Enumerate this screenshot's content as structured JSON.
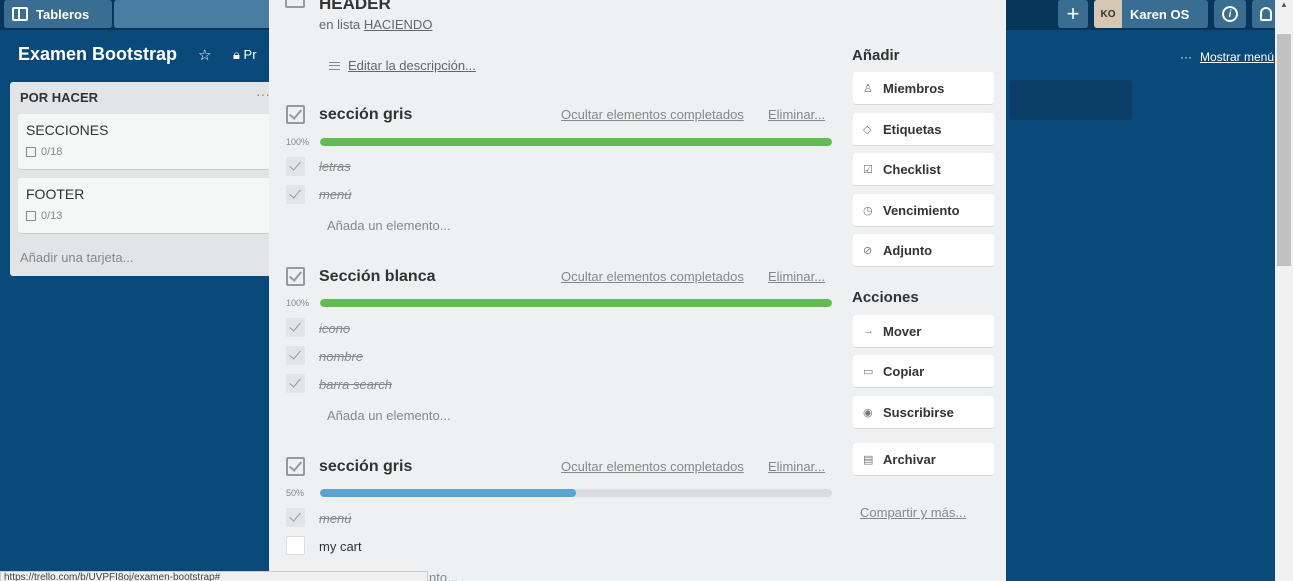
{
  "topbar": {
    "boards_label": "Tableros",
    "user_initials": "KO",
    "user_name": "Karen OS",
    "plus_glyph": "+",
    "info_glyph": "i"
  },
  "board": {
    "title": "Examen Bootstrap",
    "visibility_partial": "Pr",
    "show_menu": "Mostrar menú",
    "show_menu_dots": "···"
  },
  "list": {
    "title": "POR HACER",
    "menu_glyph": "···",
    "cards": [
      {
        "title": "SECCIONES",
        "badge": "0/18"
      },
      {
        "title": "FOOTER",
        "badge": "0/13"
      }
    ],
    "add_card": "Añadir una tarjeta..."
  },
  "card_detail": {
    "title": "HEADER",
    "in_list_prefix": "en lista ",
    "in_list_name": "HACIENDO",
    "edit_description": "Editar la descripción...",
    "checklists": [
      {
        "title": "sección gris",
        "hide_completed": "Ocultar elementos completados",
        "delete": "Eliminar...",
        "progress_label": "100%",
        "progress": 1.0,
        "bar_color": "#61bd4f",
        "items": [
          {
            "text": "letras",
            "checked": true
          },
          {
            "text": "menú",
            "checked": true
          }
        ],
        "add_item": "Añada un elemento..."
      },
      {
        "title": "Sección blanca",
        "hide_completed": "Ocultar elementos completados",
        "delete": "Eliminar...",
        "progress_label": "100%",
        "progress": 1.0,
        "bar_color": "#61bd4f",
        "items": [
          {
            "text": "icono",
            "checked": true
          },
          {
            "text": "nombre",
            "checked": true
          },
          {
            "text": "barra search",
            "checked": true
          }
        ],
        "add_item": "Añada un elemento..."
      },
      {
        "title": "sección gris",
        "hide_completed": "Ocultar elementos completados",
        "delete": "Eliminar...",
        "progress_label": "50%",
        "progress": 0.5,
        "bar_color": "#5ba4cf",
        "items": [
          {
            "text": "menú",
            "checked": true
          },
          {
            "text": "my cart",
            "checked": false
          }
        ],
        "add_item_partial": "nto..."
      }
    ],
    "sidebar": {
      "add_heading": "Añadir",
      "add_buttons": [
        {
          "label": "Miembros",
          "icon": "person-icon"
        },
        {
          "label": "Etiquetas",
          "icon": "tag-icon"
        },
        {
          "label": "Checklist",
          "icon": "checklist-icon"
        },
        {
          "label": "Vencimiento",
          "icon": "clock-icon"
        },
        {
          "label": "Adjunto",
          "icon": "paperclip-icon"
        }
      ],
      "actions_heading": "Acciones",
      "action_buttons": [
        {
          "label": "Mover",
          "icon": "arrow-right-icon"
        },
        {
          "label": "Copiar",
          "icon": "copy-icon"
        },
        {
          "label": "Suscribirse",
          "icon": "eye-icon"
        },
        {
          "label": "Archivar",
          "icon": "archive-icon"
        }
      ],
      "share_more": "Compartir y más..."
    }
  },
  "status_url": "https://trello.com/b/UVPFI8oj/examen-bootstrap#"
}
